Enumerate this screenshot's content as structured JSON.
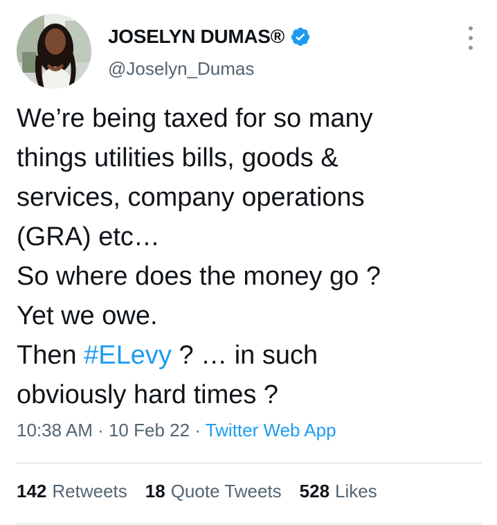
{
  "author": {
    "display_name": "JOSELYN DUMAS®",
    "handle": "@Joselyn_Dumas",
    "verified": true
  },
  "icons": {
    "verified": "verified-badge-icon",
    "more": "more-vertical-icon"
  },
  "tweet": {
    "lines": [
      "We’re being taxed for so many",
      "things utilities bills, goods &",
      "services, company operations",
      "(GRA) etc…",
      "So where does the money go ?",
      "Yet we owe."
    ],
    "line7_prefix": "Then ",
    "hashtag": "#ELevy",
    "line7_suffix": " ? … in such",
    "line8": "obviously hard times ?"
  },
  "meta": {
    "time": "10:38 AM",
    "separator": " · ",
    "date": "10 Feb 22",
    "source": "Twitter Web App"
  },
  "stats": {
    "retweets_count": "142",
    "retweets_label": "Retweets",
    "quotes_count": "18",
    "quotes_label": "Quote Tweets",
    "likes_count": "528",
    "likes_label": "Likes"
  },
  "colors": {
    "text": "#0f1419",
    "secondary": "#536471",
    "link": "#1d9bf0",
    "divider": "#cfd9de"
  }
}
